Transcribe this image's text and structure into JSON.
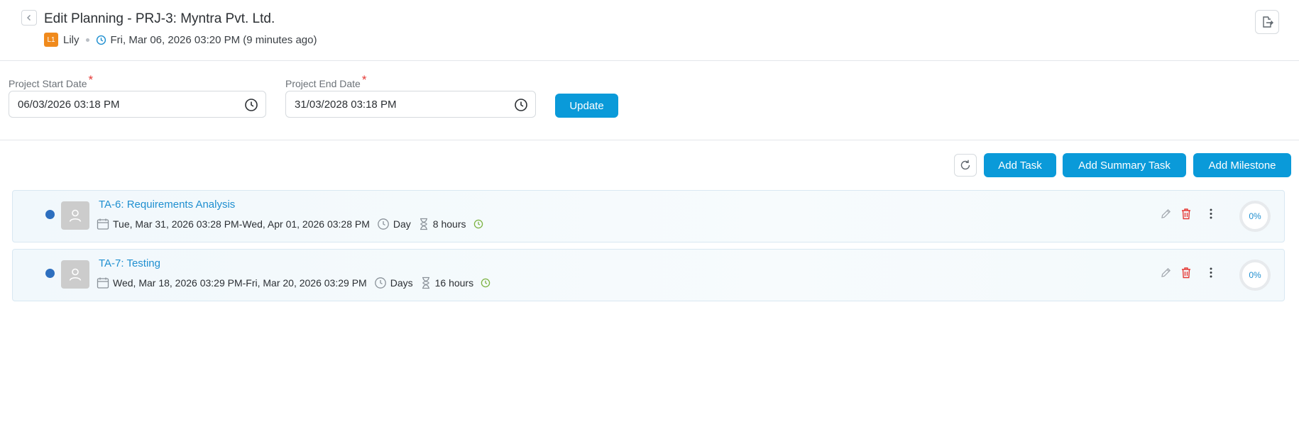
{
  "header": {
    "title": "Edit Planning - PRJ-3: Myntra Pvt. Ltd.",
    "user_initials": "L1",
    "user_name": "Lily",
    "timestamp": "Fri, Mar 06, 2026 03:20 PM (9 minutes ago)"
  },
  "dates": {
    "start_label": "Project Start Date",
    "start_value": "06/03/2026 03:18 PM",
    "end_label": "Project End Date",
    "end_value": "31/03/2028 03:18 PM",
    "required_mark": "*",
    "update_label": "Update"
  },
  "toolbar": {
    "add_task": "Add Task",
    "add_summary_task": "Add Summary Task",
    "add_milestone": "Add Milestone"
  },
  "tasks": [
    {
      "title": "TA-6: Requirements Analysis",
      "date_range": "Tue, Mar 31, 2026 03:28 PM-Wed, Apr 01, 2026 03:28 PM",
      "duration_unit": "Day",
      "hours": "8 hours",
      "progress": "0%"
    },
    {
      "title": "TA-7: Testing",
      "date_range": "Wed, Mar 18, 2026 03:29 PM-Fri, Mar 20, 2026 03:29 PM",
      "duration_unit": "Days",
      "hours": "16 hours",
      "progress": "0%"
    }
  ],
  "colors": {
    "primary": "#0a9ad9",
    "link": "#1f8fd0",
    "status_dot": "#2d6fbf",
    "avatar_badge": "#f08a1c",
    "delete": "#e53935",
    "ontime": "#7cb342"
  },
  "icons": {
    "back": "chevron-left-icon",
    "export": "export-icon",
    "clock": "clock-icon",
    "refresh": "refresh-icon",
    "calendar": "calendar-icon",
    "hourglass": "hourglass-icon",
    "edit": "pencil-icon",
    "delete": "trash-icon",
    "more": "more-vertical-icon",
    "user": "user-icon"
  }
}
